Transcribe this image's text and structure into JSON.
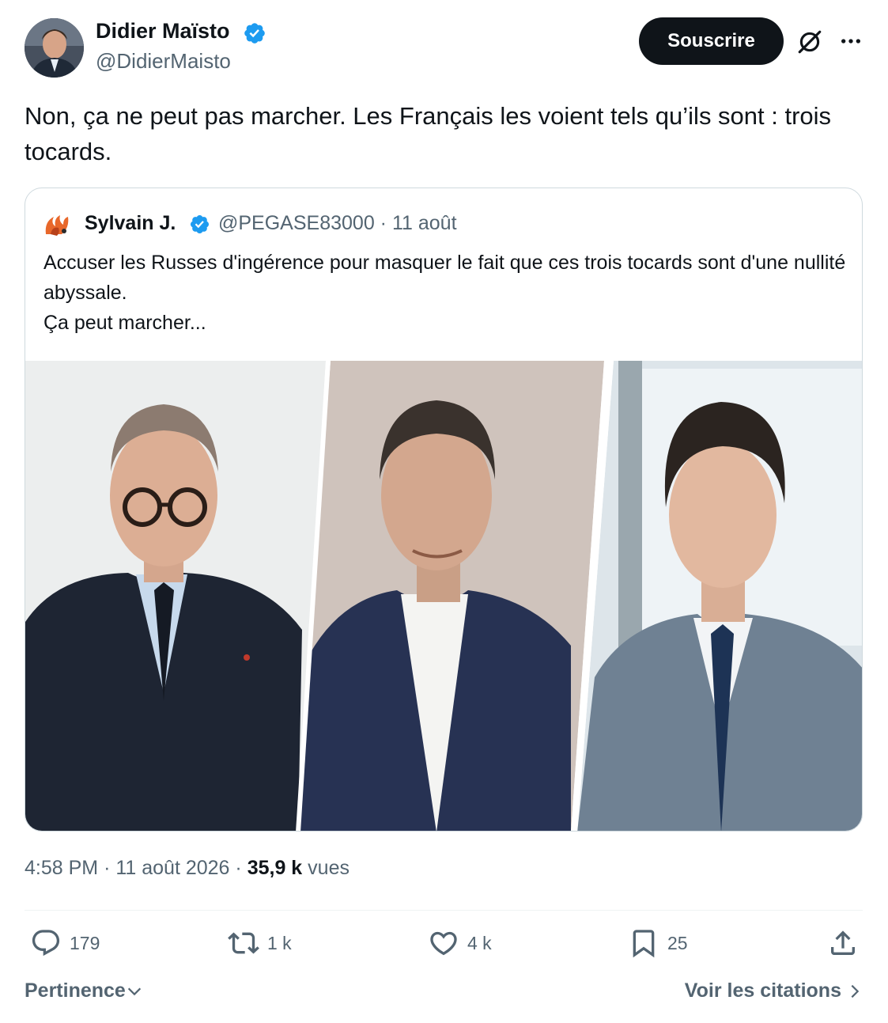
{
  "author": {
    "name": "Didier Maïsto",
    "handle": "@DidierMaisto"
  },
  "header": {
    "subscribe_label": "Souscrire",
    "grok_icon": "grok-icon",
    "more_icon": "more-icon"
  },
  "tweet": {
    "text": "Non, ça ne peut pas marcher. Les Français les voient tels qu’ils sont : trois tocards."
  },
  "quote": {
    "name": "Sylvain J.",
    "handle": "@PEGASE83000",
    "separator": "·",
    "date": "11 août",
    "lines": [
      "Accuser les Russes d'ingérence pour masquer le fait que ces trois tocards sont d'une nullité abyssale.",
      "Ça peut marcher..."
    ]
  },
  "meta": {
    "time": "4:58 PM",
    "sep1": "·",
    "date": "11 août 2026",
    "sep2": "·",
    "views_count": "35,9 k",
    "views_label": "vues"
  },
  "actions": {
    "reply_count": "179",
    "retweet_count": "1 k",
    "like_count": "4 k",
    "bookmark_count": "25"
  },
  "footer": {
    "sort_label": "Pertinence",
    "citations_label": "Voir les citations"
  },
  "colors": {
    "verified": "#1d9bf0",
    "text": "#0f1419",
    "secondary": "#536471",
    "border": "#cfd9de"
  }
}
